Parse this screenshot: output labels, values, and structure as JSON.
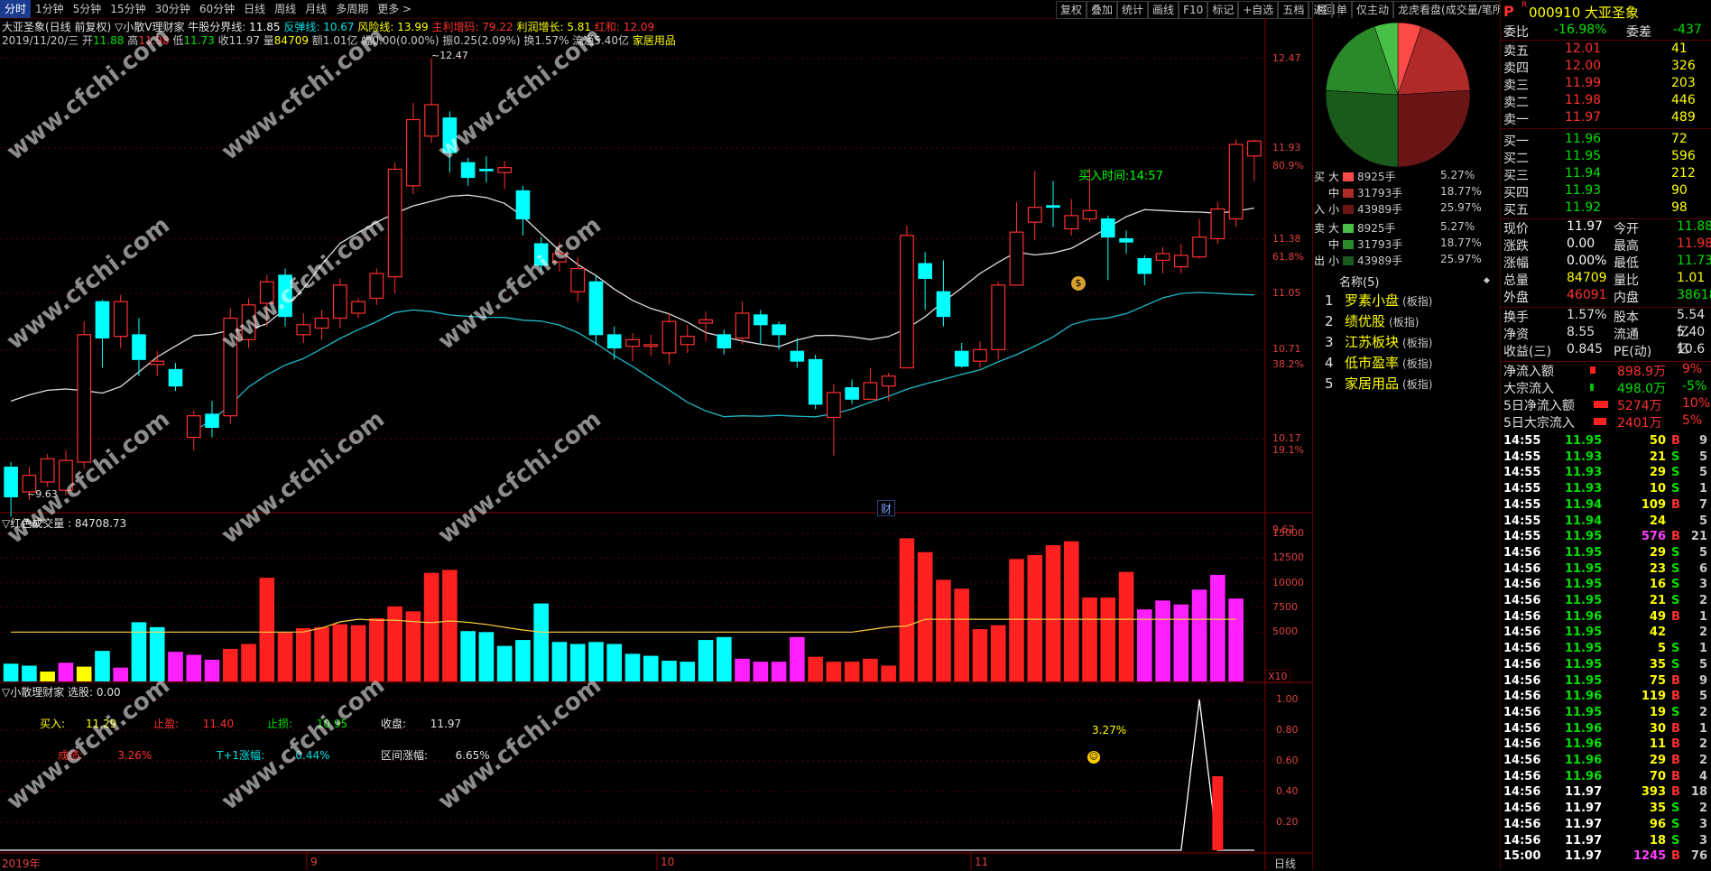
{
  "topbar": {
    "tabs": [
      "分时",
      "1分钟",
      "5分钟",
      "15分钟",
      "30分钟",
      "60分钟",
      "日线",
      "周线",
      "月线",
      "多周期",
      "更多 >"
    ],
    "tools": [
      "复权",
      "叠加",
      "统计",
      "画线",
      "F10",
      "标记",
      "+自选",
      "五档",
      "返回"
    ],
    "side_tabs": [
      "柱",
      "单",
      "仅主动",
      "龙虎看盘(成交量/笔所有)"
    ]
  },
  "header": {
    "line1": {
      "stock": "大亚圣象(日线 前复权)",
      "indicator": "▽小散V理财家",
      "k1": "牛股分界线: ",
      "v1": "11.85",
      "k2": "反弹线: ",
      "v2": "10.67",
      "k3": "风险线: ",
      "v3": "13.99",
      "k4": "主利增码: ",
      "v4": "79.22",
      "k5": "利润增长: ",
      "v5": "5.81",
      "k6": "红和: ",
      "v6": "12.09"
    },
    "line2": {
      "date": "2019/11/20/三",
      "open_k": " 开",
      "open": "11.88",
      "high_k": " 高",
      "high": "11.98",
      "low_k": " 低",
      "low": "11.73",
      "close_k": " 收",
      "close": "11.97",
      "vol_k": " 量",
      "vol": "84709",
      "rest": " 额1.01亿 幅0.00(0.00%) 振0.25(2.09%) 换1.57% 流通5.40亿",
      "sector": "家居用品"
    }
  },
  "main_chart": {
    "y_labels": [
      "12.47",
      "11.93",
      "11.38",
      "11.05",
      "10.71",
      "10.17",
      "9.62"
    ],
    "pct_labels": [
      "80.9%",
      "61.8%",
      "38.2%",
      "19.1%"
    ],
    "peak_label": "12.47",
    "low_label": "9.63",
    "buy_time_label": "买入时间:14:57",
    "cai_label": "财",
    "coin_icon": "coin-icon",
    "x_labels": [
      "2019年",
      "9",
      "10",
      "11"
    ],
    "period_label": "日线"
  },
  "volume_panel": {
    "title": "▽红色成交量 : 84708.73",
    "y_labels": [
      "15000",
      "12500",
      "10000",
      "7500",
      "5000"
    ],
    "unit": "X10"
  },
  "signal_panel": {
    "title": "▽小散理财家  选股: 0.00",
    "buy_k": "买入:",
    "buy_v": "11.29",
    "tp_k": "止盈:",
    "tp_v": "11.40",
    "sl_k": "止损:",
    "sl_v": "10.95",
    "close_k": "收盘:",
    "close_v": "11.97",
    "res_k": "成绩:",
    "res_v": "3.26%",
    "t1_k": "T+1涨幅:",
    "t1_v": "0.44%",
    "range_k": "区间涨幅:",
    "range_v": "6.65%",
    "pct_label": "3.27%",
    "y_labels": [
      "1.00",
      "0.80",
      "0.60",
      "0.40",
      "0.20"
    ]
  },
  "moneyflow": {
    "buy_rows": [
      {
        "size": "大",
        "lots": "8925手",
        "pct": "5.27%"
      },
      {
        "size": "中",
        "lots": "31793手",
        "pct": "18.77%"
      },
      {
        "size": "小",
        "lots": "43989手",
        "pct": "25.97%"
      }
    ],
    "sell_rows": [
      {
        "size": "大",
        "lots": "8925手",
        "pct": "5.27%"
      },
      {
        "size": "中",
        "lots": "31793手",
        "pct": "18.77%"
      },
      {
        "size": "小",
        "lots": "43989手",
        "pct": "25.97%"
      }
    ],
    "side_buy": [
      "买",
      "入"
    ],
    "side_sell": [
      "卖",
      "出"
    ],
    "pie": [
      {
        "value": 5.27,
        "color": "#ff4a4a"
      },
      {
        "value": 18.77,
        "color": "#b02a2a"
      },
      {
        "value": 25.97,
        "color": "#6a1616"
      },
      {
        "value": 25.97,
        "color": "#1a5a1a"
      },
      {
        "value": 18.77,
        "color": "#2a8a2a"
      },
      {
        "value": 5.27,
        "color": "#48c048"
      }
    ]
  },
  "boards": {
    "title": "名称(5)",
    "items": [
      {
        "no": "1",
        "name": "罗素小盘",
        "tag": "(板指)"
      },
      {
        "no": "2",
        "name": "绩优股",
        "tag": "(板指)"
      },
      {
        "no": "3",
        "name": "江苏板块",
        "tag": "(板指)"
      },
      {
        "no": "4",
        "name": "低市盈率",
        "tag": "(板指)"
      },
      {
        "no": "5",
        "name": "家居用品",
        "tag": "(板指)"
      }
    ]
  },
  "quote": {
    "code": "000910",
    "name": "大亚圣象",
    "ratio_k": "委比",
    "ratio_v": "-16.98%",
    "diff_k": "委差",
    "diff_v": "-437",
    "sells": [
      {
        "k": "卖五",
        "p": "12.01",
        "v": "41"
      },
      {
        "k": "卖四",
        "p": "12.00",
        "v": "326"
      },
      {
        "k": "卖三",
        "p": "11.99",
        "v": "203"
      },
      {
        "k": "卖二",
        "p": "11.98",
        "v": "446"
      },
      {
        "k": "卖一",
        "p": "11.97",
        "v": "489"
      }
    ],
    "buys": [
      {
        "k": "买一",
        "p": "11.96",
        "v": "72"
      },
      {
        "k": "买二",
        "p": "11.95",
        "v": "596"
      },
      {
        "k": "买三",
        "p": "11.94",
        "v": "212"
      },
      {
        "k": "买四",
        "p": "11.93",
        "v": "90"
      },
      {
        "k": "买五",
        "p": "11.92",
        "v": "98"
      }
    ],
    "stats": [
      {
        "k1": "现价",
        "v1": "11.97",
        "k2": "今开",
        "v2": "11.88"
      },
      {
        "k1": "涨跌",
        "v1": "0.00",
        "k2": "最高",
        "v2": "11.98"
      },
      {
        "k1": "涨幅",
        "v1": "0.00%",
        "k2": "最低",
        "v2": "11.73"
      },
      {
        "k1": "总量",
        "v1": "84709",
        "k2": "量比",
        "v2": "1.01"
      },
      {
        "k1": "外盘",
        "v1": "46091",
        "k2": "内盘",
        "v2": "38618"
      }
    ],
    "stats2": [
      {
        "k1": "换手",
        "v1": "1.57%",
        "k2": "股本",
        "v2": "5.54亿"
      },
      {
        "k1": "净资",
        "v1": "8.55",
        "k2": "流通",
        "v2": "5.40亿"
      },
      {
        "k1": "收益(三)",
        "v1": "0.845",
        "k2": "PE(动)",
        "v2": "10.6"
      }
    ],
    "flows": [
      {
        "k": "净流入额",
        "v": "898.9万",
        "p": "9%"
      },
      {
        "k": "大宗流入",
        "v": "498.0万",
        "p": "-5%"
      },
      {
        "k": "5日净流入额",
        "v": "5274万",
        "p": "10%"
      },
      {
        "k": "5日大宗流入",
        "v": "2401万",
        "p": "5%"
      }
    ]
  },
  "ticks": [
    {
      "t": "14:55",
      "p": "11.95",
      "v": "50",
      "d": "B",
      "n": "9"
    },
    {
      "t": "14:55",
      "p": "11.93",
      "v": "21",
      "d": "S",
      "n": "5"
    },
    {
      "t": "14:55",
      "p": "11.93",
      "v": "29",
      "d": "S",
      "n": "5"
    },
    {
      "t": "14:55",
      "p": "11.93",
      "v": "10",
      "d": "S",
      "n": "1"
    },
    {
      "t": "14:55",
      "p": "11.94",
      "v": "109",
      "d": "B",
      "n": "7"
    },
    {
      "t": "14:55",
      "p": "11.94",
      "v": "24",
      "d": "",
      "n": "5"
    },
    {
      "t": "14:55",
      "p": "11.95",
      "v": "576",
      "d": "B",
      "n": "21"
    },
    {
      "t": "14:56",
      "p": "11.95",
      "v": "29",
      "d": "S",
      "n": "5"
    },
    {
      "t": "14:56",
      "p": "11.95",
      "v": "23",
      "d": "S",
      "n": "6"
    },
    {
      "t": "14:56",
      "p": "11.95",
      "v": "16",
      "d": "S",
      "n": "3"
    },
    {
      "t": "14:56",
      "p": "11.95",
      "v": "21",
      "d": "S",
      "n": "2"
    },
    {
      "t": "14:56",
      "p": "11.96",
      "v": "49",
      "d": "B",
      "n": "1"
    },
    {
      "t": "14:56",
      "p": "11.95",
      "v": "42",
      "d": "",
      "n": "2"
    },
    {
      "t": "14:56",
      "p": "11.95",
      "v": "5",
      "d": "S",
      "n": "1"
    },
    {
      "t": "14:56",
      "p": "11.95",
      "v": "35",
      "d": "S",
      "n": "5"
    },
    {
      "t": "14:56",
      "p": "11.95",
      "v": "75",
      "d": "B",
      "n": "9"
    },
    {
      "t": "14:56",
      "p": "11.96",
      "v": "119",
      "d": "B",
      "n": "5"
    },
    {
      "t": "14:56",
      "p": "11.95",
      "v": "19",
      "d": "S",
      "n": "2"
    },
    {
      "t": "14:56",
      "p": "11.96",
      "v": "30",
      "d": "B",
      "n": "1"
    },
    {
      "t": "14:56",
      "p": "11.96",
      "v": "11",
      "d": "B",
      "n": "2"
    },
    {
      "t": "14:56",
      "p": "11.96",
      "v": "29",
      "d": "B",
      "n": "2"
    },
    {
      "t": "14:56",
      "p": "11.96",
      "v": "70",
      "d": "B",
      "n": "4"
    },
    {
      "t": "14:56",
      "p": "11.97",
      "v": "393",
      "d": "B",
      "n": "18"
    },
    {
      "t": "14:56",
      "p": "11.97",
      "v": "35",
      "d": "S",
      "n": "2"
    },
    {
      "t": "14:56",
      "p": "11.97",
      "v": "96",
      "d": "S",
      "n": "3"
    },
    {
      "t": "14:56",
      "p": "11.97",
      "v": "18",
      "d": "S",
      "n": "3"
    },
    {
      "t": "15:00",
      "p": "11.97",
      "v": "1245",
      "d": "B",
      "n": "76"
    }
  ],
  "watermark": "www.cfchi.com",
  "chart_data": {
    "type": "candlestick",
    "candles": [
      [
        10.0,
        9.82,
        10.03,
        9.7
      ],
      [
        9.85,
        9.95,
        10.0,
        9.8
      ],
      [
        9.91,
        10.05,
        10.08,
        9.88
      ],
      [
        9.86,
        10.04,
        10.1,
        9.83
      ],
      [
        10.03,
        10.8,
        10.88,
        9.99
      ],
      [
        11.0,
        10.78,
        11.01,
        10.6
      ],
      [
        10.79,
        11.0,
        11.04,
        10.72
      ],
      [
        10.8,
        10.65,
        10.9,
        10.55
      ],
      [
        10.62,
        10.64,
        10.7,
        10.55
      ],
      [
        10.59,
        10.49,
        10.63,
        10.46
      ],
      [
        10.18,
        10.31,
        10.34,
        10.1
      ],
      [
        10.32,
        10.24,
        10.4,
        10.18
      ],
      [
        10.31,
        10.9,
        10.96,
        10.26
      ],
      [
        10.77,
        10.98,
        11.02,
        10.72
      ],
      [
        10.99,
        11.12,
        11.16,
        10.85
      ],
      [
        11.16,
        10.91,
        11.2,
        10.85
      ],
      [
        10.8,
        10.86,
        10.93,
        10.75
      ],
      [
        10.84,
        10.9,
        10.95,
        10.77
      ],
      [
        10.9,
        11.1,
        11.14,
        10.84
      ],
      [
        10.93,
        11.0,
        11.02,
        10.9
      ],
      [
        11.02,
        11.17,
        11.2,
        10.98
      ],
      [
        11.15,
        11.8,
        11.84,
        11.05
      ],
      [
        11.7,
        12.1,
        12.2,
        11.65
      ],
      [
        12.0,
        12.19,
        12.47,
        11.96
      ],
      [
        12.11,
        11.9,
        12.15,
        11.78
      ],
      [
        11.84,
        11.75,
        11.87,
        11.7
      ],
      [
        11.8,
        11.79,
        11.88,
        11.72
      ],
      [
        11.78,
        11.81,
        11.85,
        11.68
      ],
      [
        11.67,
        11.5,
        11.7,
        11.4
      ],
      [
        11.35,
        11.22,
        11.39,
        11.18
      ],
      [
        11.24,
        11.29,
        11.36,
        11.18
      ],
      [
        11.06,
        11.2,
        11.27,
        11.0
      ],
      [
        11.12,
        10.8,
        11.16,
        10.74
      ],
      [
        10.8,
        10.72,
        10.85,
        10.65
      ],
      [
        10.73,
        10.77,
        10.81,
        10.64
      ],
      [
        10.73,
        10.74,
        10.8,
        10.67
      ],
      [
        10.69,
        10.88,
        10.93,
        10.62
      ],
      [
        10.74,
        10.79,
        10.86,
        10.69
      ],
      [
        10.87,
        10.89,
        10.94,
        10.76
      ],
      [
        10.8,
        10.72,
        10.83,
        10.68
      ],
      [
        10.78,
        10.93,
        11.0,
        10.74
      ],
      [
        10.92,
        10.86,
        10.95,
        10.74
      ],
      [
        10.86,
        10.8,
        10.88,
        10.71
      ],
      [
        10.7,
        10.64,
        10.78,
        10.6
      ],
      [
        10.65,
        10.38,
        10.68,
        10.35
      ],
      [
        10.3,
        10.45,
        10.5,
        10.07
      ],
      [
        10.48,
        10.41,
        10.53,
        10.38
      ],
      [
        10.41,
        10.51,
        10.6,
        10.42
      ],
      [
        10.49,
        10.55,
        10.57,
        10.4
      ],
      [
        10.6,
        11.4,
        11.46,
        10.6
      ],
      [
        11.23,
        11.14,
        11.3,
        10.95
      ],
      [
        11.06,
        10.91,
        11.25,
        10.85
      ],
      [
        10.7,
        10.61,
        10.75,
        10.6
      ],
      [
        10.64,
        10.71,
        10.76,
        10.6
      ],
      [
        10.71,
        11.1,
        11.12,
        10.65
      ],
      [
        11.1,
        11.42,
        11.6,
        11.1
      ],
      [
        11.48,
        11.57,
        11.79,
        11.37
      ],
      [
        11.58,
        11.57,
        11.73,
        11.45
      ],
      [
        11.44,
        11.52,
        11.62,
        11.4
      ],
      [
        11.5,
        11.55,
        11.8,
        11.48
      ],
      [
        11.5,
        11.39,
        11.52,
        11.13
      ],
      [
        11.38,
        11.36,
        11.43,
        11.29
      ],
      [
        11.26,
        11.17,
        11.28,
        11.1
      ],
      [
        11.25,
        11.29,
        11.33,
        11.17
      ],
      [
        11.21,
        11.28,
        11.35,
        11.17
      ],
      [
        11.27,
        11.39,
        11.5,
        11.26
      ],
      [
        11.38,
        11.56,
        11.6,
        11.35
      ],
      [
        11.5,
        11.95,
        11.98,
        11.45
      ],
      [
        11.88,
        11.97,
        11.98,
        11.73
      ]
    ],
    "volume": [
      [
        1800,
        "c"
      ],
      [
        1600,
        "c"
      ],
      [
        1000,
        "y"
      ],
      [
        1900,
        "m"
      ],
      [
        1500,
        "y"
      ],
      [
        3100,
        "c"
      ],
      [
        1400,
        "m"
      ],
      [
        6000,
        "c"
      ],
      [
        5500,
        "c"
      ],
      [
        3000,
        "m"
      ],
      [
        2700,
        "m"
      ],
      [
        2200,
        "m"
      ],
      [
        3300,
        "r"
      ],
      [
        3800,
        "r"
      ],
      [
        10500,
        "r"
      ],
      [
        5000,
        "r"
      ],
      [
        5400,
        "r"
      ],
      [
        5500,
        "r"
      ],
      [
        5800,
        "r"
      ],
      [
        5700,
        "r"
      ],
      [
        6400,
        "r"
      ],
      [
        7600,
        "r"
      ],
      [
        7100,
        "r"
      ],
      [
        11000,
        "r"
      ],
      [
        11300,
        "r"
      ],
      [
        5100,
        "c"
      ],
      [
        5000,
        "c"
      ],
      [
        3600,
        "c"
      ],
      [
        4200,
        "c"
      ],
      [
        7900,
        "c"
      ],
      [
        4000,
        "c"
      ],
      [
        3800,
        "c"
      ],
      [
        4000,
        "c"
      ],
      [
        3800,
        "c"
      ],
      [
        2800,
        "c"
      ],
      [
        2600,
        "c"
      ],
      [
        2100,
        "c"
      ],
      [
        2000,
        "c"
      ],
      [
        4200,
        "c"
      ],
      [
        4500,
        "c"
      ],
      [
        2300,
        "m"
      ],
      [
        2000,
        "m"
      ],
      [
        2000,
        "m"
      ],
      [
        4500,
        "m"
      ],
      [
        2500,
        "r"
      ],
      [
        2000,
        "r"
      ],
      [
        2000,
        "r"
      ],
      [
        2300,
        "r"
      ],
      [
        1600,
        "r"
      ],
      [
        14500,
        "r"
      ],
      [
        13100,
        "r"
      ],
      [
        10300,
        "r"
      ],
      [
        9400,
        "r"
      ],
      [
        5300,
        "r"
      ],
      [
        5700,
        "r"
      ],
      [
        12400,
        "r"
      ],
      [
        12800,
        "r"
      ],
      [
        13800,
        "r"
      ],
      [
        14200,
        "r"
      ],
      [
        8500,
        "r"
      ],
      [
        8500,
        "r"
      ],
      [
        11100,
        "r"
      ],
      [
        7300,
        "m"
      ],
      [
        8200,
        "m"
      ],
      [
        7800,
        "m"
      ],
      [
        9300,
        "m"
      ],
      [
        10800,
        "m"
      ],
      [
        8400,
        "m"
      ]
    ]
  }
}
